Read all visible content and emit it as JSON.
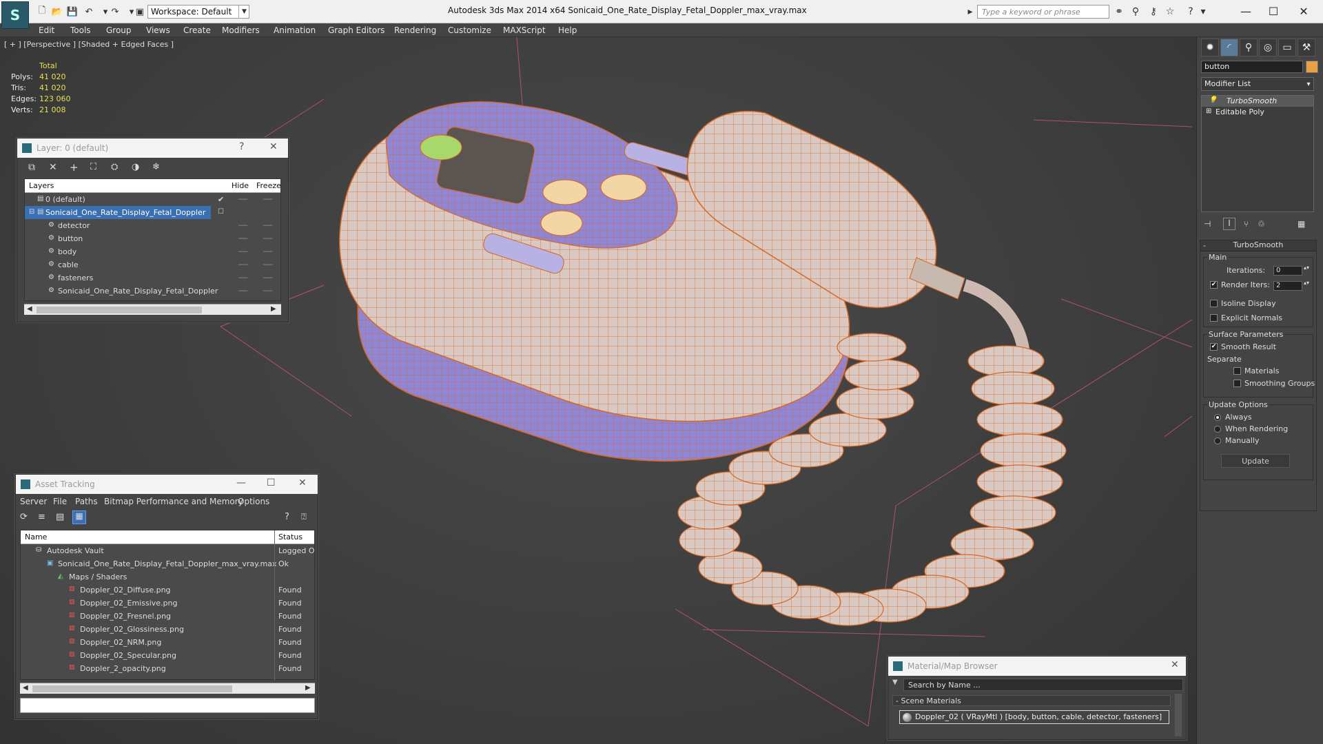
{
  "titlebar": {
    "workspace": "Workspace: Default",
    "app_title": "Autodesk 3ds Max  2014 x64      Sonicaid_One_Rate_Display_Fetal_Doppler_max_vray.max",
    "search_placeholder": "Type a keyword or phrase"
  },
  "menu": [
    "Edit",
    "Tools",
    "Group",
    "Views",
    "Create",
    "Modifiers",
    "Animation",
    "Graph Editors",
    "Rendering",
    "Customize",
    "MAXScript",
    "Help"
  ],
  "viewport": {
    "label": "[ + ] [Perspective ] [Shaded + Edged Faces ]",
    "stats": {
      "header": "Total",
      "rows": [
        {
          "k": "Polys:",
          "v": "41 020"
        },
        {
          "k": "Tris:",
          "v": "41 020"
        },
        {
          "k": "Edges:",
          "v": "123 060"
        },
        {
          "k": "Verts:",
          "v": "21 008"
        }
      ]
    },
    "colors": {
      "wire": "#d9661f",
      "body": "#d9c9c2",
      "accent": "#8f86d6",
      "grid": "#e05a8a"
    }
  },
  "layer_window": {
    "title": "Layer: 0 (default)",
    "help": "?",
    "close": "✕",
    "columns": {
      "layers": "Layers",
      "hide": "Hide",
      "freeze": "Freeze"
    },
    "rows": [
      {
        "name": "0 (default)",
        "level": 0,
        "checked": true
      },
      {
        "name": "Sonicaid_One_Rate_Display_Fetal_Doppler",
        "level": 0,
        "selected": true
      },
      {
        "name": "detector",
        "level": 1
      },
      {
        "name": "button",
        "level": 1
      },
      {
        "name": "body",
        "level": 1
      },
      {
        "name": "cable",
        "level": 1
      },
      {
        "name": "fasteners",
        "level": 1
      },
      {
        "name": "Sonicaid_One_Rate_Display_Fetal_Doppler",
        "level": 1
      }
    ]
  },
  "asset_window": {
    "title": "Asset Tracking",
    "menu": [
      "Server",
      "File",
      "Paths",
      "Bitmap Performance and Memory",
      "Options"
    ],
    "columns": {
      "name": "Name",
      "status": "Status"
    },
    "rows": [
      {
        "name": "Autodesk Vault",
        "status": "Logged O",
        "level": 1,
        "icon": "vault-icon"
      },
      {
        "name": "Sonicaid_One_Rate_Display_Fetal_Doppler_max_vray.max",
        "status": "Ok",
        "level": 2,
        "icon": "max-file-icon"
      },
      {
        "name": "Maps / Shaders",
        "status": "",
        "level": 3,
        "icon": "maps-icon"
      },
      {
        "name": "Doppler_02_Diffuse.png",
        "status": "Found",
        "level": 4,
        "icon": "png-icon"
      },
      {
        "name": "Doppler_02_Emissive.png",
        "status": "Found",
        "level": 4,
        "icon": "png-icon"
      },
      {
        "name": "Doppler_02_Fresnel.png",
        "status": "Found",
        "level": 4,
        "icon": "png-icon"
      },
      {
        "name": "Doppler_02_Glossiness.png",
        "status": "Found",
        "level": 4,
        "icon": "png-icon"
      },
      {
        "name": "Doppler_02_NRM.png",
        "status": "Found",
        "level": 4,
        "icon": "png-icon"
      },
      {
        "name": "Doppler_02_Specular.png",
        "status": "Found",
        "level": 4,
        "icon": "png-icon"
      },
      {
        "name": "Doppler_2_opacity.png",
        "status": "Found",
        "level": 4,
        "icon": "png-icon"
      }
    ]
  },
  "material_window": {
    "title": "Material/Map Browser",
    "search_placeholder": "Search by Name ...",
    "section": "- Scene Materials",
    "item": "Doppler_02  ( VRayMtl ) [body, button, cable, detector, fasteners]"
  },
  "command_panel": {
    "object_name": "button",
    "modifier_list": "Modifier List",
    "stack": [
      "TurboSmooth",
      "Editable Poly"
    ],
    "rollout_title": "TurboSmooth",
    "main_label": "Main",
    "iterations_label": "Iterations:",
    "iterations_value": "0",
    "render_iters_label": "Render Iters:",
    "render_iters_value": "2",
    "isoline_label": "Isoline Display",
    "explicit_normals_label": "Explicit Normals",
    "surface_params_label": "Surface Parameters",
    "smooth_result_label": "Smooth Result",
    "separate_label": "Separate",
    "materials_label": "Materials",
    "smoothing_groups_label": "Smoothing Groups",
    "update_options_label": "Update Options",
    "always_label": "Always",
    "when_rendering_label": "When Rendering",
    "manually_label": "Manually",
    "update_button": "Update"
  }
}
